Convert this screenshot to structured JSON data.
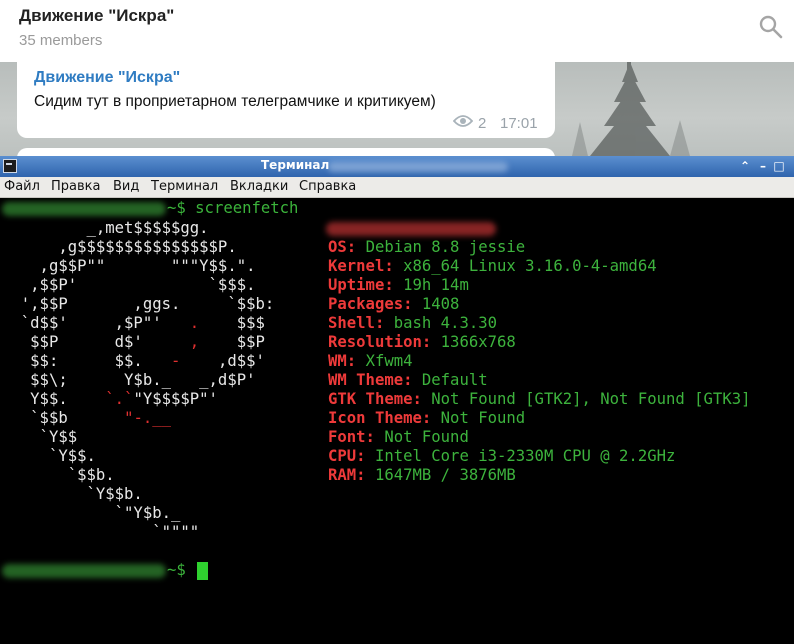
{
  "telegram": {
    "chat_title": "Движение \"Искра\"",
    "members": "35 members",
    "message": {
      "author": "Движение \"Искра\"",
      "text": "Сидим тут в проприетарном телеграмчике и критикуем)",
      "views": "2",
      "time": "17:01"
    }
  },
  "window": {
    "title": "Терминал",
    "buttons": [
      "⌃",
      "–",
      "□",
      "✕"
    ],
    "menu": [
      "Файл",
      "Правка",
      "Вид",
      "Терминал",
      "Вкладки",
      "Справка"
    ]
  },
  "terminal": {
    "command_prompt": "~$ screenfetch",
    "end_prompt": "~$",
    "logo_lines": [
      "         _,met$$$$$gg.",
      "      ,g$$$$$$$$$$$$$$$P.",
      "    ,g$$P\"\"       \"\"\"Y$$.\".",
      "   ,$$P'              `$$$.",
      "  ',$$P       ,ggs.     `$$b:",
      "  `d$$'     ,$P\"'   .    $$$",
      "   $$P      d$'     ,    $$P",
      "   $$:      $$.   -    ,d$$'",
      "   $$\\;      Y$b._   _,d$P'",
      "   Y$$.    `.`\"Y$$$$P\"'",
      "   `$$b      \"-.__",
      "    `Y$$",
      "     `Y$$.",
      "       `$$b.",
      "         `Y$$b.",
      "            `\"Y$b._",
      "                `\"\"\"\""
    ],
    "info": [
      {
        "key": "OS:",
        "value": "Debian 8.8 jessie"
      },
      {
        "key": "Kernel:",
        "value": "x86_64 Linux 3.16.0-4-amd64"
      },
      {
        "key": "Uptime:",
        "value": "19h 14m"
      },
      {
        "key": "Packages:",
        "value": "1408"
      },
      {
        "key": "Shell:",
        "value": "bash 4.3.30"
      },
      {
        "key": "Resolution:",
        "value": "1366x768"
      },
      {
        "key": "WM:",
        "value": "Xfwm4"
      },
      {
        "key": "WM Theme:",
        "value": "Default"
      },
      {
        "key": "GTK Theme:",
        "value": "Not Found [GTK2], Not Found [GTK3]"
      },
      {
        "key": "Icon Theme:",
        "value": "Not Found"
      },
      {
        "key": "Font:",
        "value": "Not Found"
      },
      {
        "key": "CPU:",
        "value": "Intel Core i3-2330M CPU @ 2.2GHz"
      },
      {
        "key": "RAM:",
        "value": "1647MB / 3876MB"
      }
    ]
  },
  "colors": {
    "prompt": "#3bb33b",
    "key": "#ee3a3a",
    "value": "#3db33d",
    "titlebar": "#2f64ad",
    "link": "#2f7cc2"
  }
}
